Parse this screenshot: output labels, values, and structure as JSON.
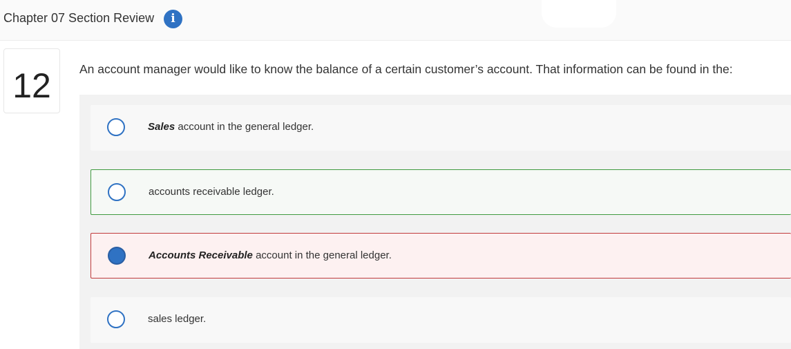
{
  "header": {
    "title": "Chapter 07 Section Review",
    "info_icon": "info-icon"
  },
  "question": {
    "number": "12",
    "prompt": "An account manager would like to know the balance of a certain customer’s account. That information can be found in the:"
  },
  "choices": [
    {
      "emphasis": "Sales",
      "text": " account in the general ledger.",
      "state": "normal",
      "selected": false
    },
    {
      "emphasis": "",
      "text": "accounts receivable ledger.",
      "state": "correct",
      "selected": false
    },
    {
      "emphasis": "Accounts Receivable",
      "text": " account in the general ledger.",
      "state": "incorrect",
      "selected": true
    },
    {
      "emphasis": "",
      "text": "sales ledger.",
      "state": "normal",
      "selected": false
    }
  ],
  "colors": {
    "accent": "#2f72c3",
    "correct_border": "#3f9a3f",
    "incorrect_border": "#c0393b",
    "incorrect_bg": "#fdf1f1"
  }
}
